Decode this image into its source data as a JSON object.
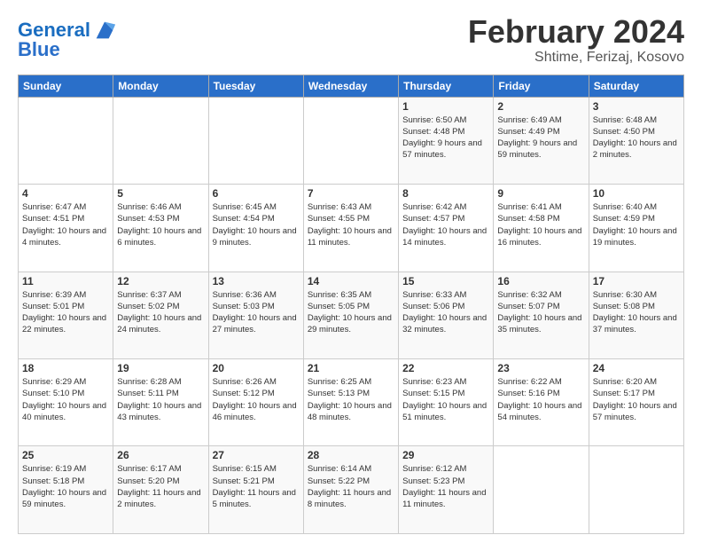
{
  "header": {
    "logo_line1": "General",
    "logo_line2": "Blue",
    "month_year": "February 2024",
    "location": "Shtime, Ferizaj, Kosovo"
  },
  "weekdays": [
    "Sunday",
    "Monday",
    "Tuesday",
    "Wednesday",
    "Thursday",
    "Friday",
    "Saturday"
  ],
  "weeks": [
    [
      {
        "day": "",
        "info": ""
      },
      {
        "day": "",
        "info": ""
      },
      {
        "day": "",
        "info": ""
      },
      {
        "day": "",
        "info": ""
      },
      {
        "day": "1",
        "info": "Sunrise: 6:50 AM\nSunset: 4:48 PM\nDaylight: 9 hours\nand 57 minutes."
      },
      {
        "day": "2",
        "info": "Sunrise: 6:49 AM\nSunset: 4:49 PM\nDaylight: 9 hours\nand 59 minutes."
      },
      {
        "day": "3",
        "info": "Sunrise: 6:48 AM\nSunset: 4:50 PM\nDaylight: 10 hours\nand 2 minutes."
      }
    ],
    [
      {
        "day": "4",
        "info": "Sunrise: 6:47 AM\nSunset: 4:51 PM\nDaylight: 10 hours\nand 4 minutes."
      },
      {
        "day": "5",
        "info": "Sunrise: 6:46 AM\nSunset: 4:53 PM\nDaylight: 10 hours\nand 6 minutes."
      },
      {
        "day": "6",
        "info": "Sunrise: 6:45 AM\nSunset: 4:54 PM\nDaylight: 10 hours\nand 9 minutes."
      },
      {
        "day": "7",
        "info": "Sunrise: 6:43 AM\nSunset: 4:55 PM\nDaylight: 10 hours\nand 11 minutes."
      },
      {
        "day": "8",
        "info": "Sunrise: 6:42 AM\nSunset: 4:57 PM\nDaylight: 10 hours\nand 14 minutes."
      },
      {
        "day": "9",
        "info": "Sunrise: 6:41 AM\nSunset: 4:58 PM\nDaylight: 10 hours\nand 16 minutes."
      },
      {
        "day": "10",
        "info": "Sunrise: 6:40 AM\nSunset: 4:59 PM\nDaylight: 10 hours\nand 19 minutes."
      }
    ],
    [
      {
        "day": "11",
        "info": "Sunrise: 6:39 AM\nSunset: 5:01 PM\nDaylight: 10 hours\nand 22 minutes."
      },
      {
        "day": "12",
        "info": "Sunrise: 6:37 AM\nSunset: 5:02 PM\nDaylight: 10 hours\nand 24 minutes."
      },
      {
        "day": "13",
        "info": "Sunrise: 6:36 AM\nSunset: 5:03 PM\nDaylight: 10 hours\nand 27 minutes."
      },
      {
        "day": "14",
        "info": "Sunrise: 6:35 AM\nSunset: 5:05 PM\nDaylight: 10 hours\nand 29 minutes."
      },
      {
        "day": "15",
        "info": "Sunrise: 6:33 AM\nSunset: 5:06 PM\nDaylight: 10 hours\nand 32 minutes."
      },
      {
        "day": "16",
        "info": "Sunrise: 6:32 AM\nSunset: 5:07 PM\nDaylight: 10 hours\nand 35 minutes."
      },
      {
        "day": "17",
        "info": "Sunrise: 6:30 AM\nSunset: 5:08 PM\nDaylight: 10 hours\nand 37 minutes."
      }
    ],
    [
      {
        "day": "18",
        "info": "Sunrise: 6:29 AM\nSunset: 5:10 PM\nDaylight: 10 hours\nand 40 minutes."
      },
      {
        "day": "19",
        "info": "Sunrise: 6:28 AM\nSunset: 5:11 PM\nDaylight: 10 hours\nand 43 minutes."
      },
      {
        "day": "20",
        "info": "Sunrise: 6:26 AM\nSunset: 5:12 PM\nDaylight: 10 hours\nand 46 minutes."
      },
      {
        "day": "21",
        "info": "Sunrise: 6:25 AM\nSunset: 5:13 PM\nDaylight: 10 hours\nand 48 minutes."
      },
      {
        "day": "22",
        "info": "Sunrise: 6:23 AM\nSunset: 5:15 PM\nDaylight: 10 hours\nand 51 minutes."
      },
      {
        "day": "23",
        "info": "Sunrise: 6:22 AM\nSunset: 5:16 PM\nDaylight: 10 hours\nand 54 minutes."
      },
      {
        "day": "24",
        "info": "Sunrise: 6:20 AM\nSunset: 5:17 PM\nDaylight: 10 hours\nand 57 minutes."
      }
    ],
    [
      {
        "day": "25",
        "info": "Sunrise: 6:19 AM\nSunset: 5:18 PM\nDaylight: 10 hours\nand 59 minutes."
      },
      {
        "day": "26",
        "info": "Sunrise: 6:17 AM\nSunset: 5:20 PM\nDaylight: 11 hours\nand 2 minutes."
      },
      {
        "day": "27",
        "info": "Sunrise: 6:15 AM\nSunset: 5:21 PM\nDaylight: 11 hours\nand 5 minutes."
      },
      {
        "day": "28",
        "info": "Sunrise: 6:14 AM\nSunset: 5:22 PM\nDaylight: 11 hours\nand 8 minutes."
      },
      {
        "day": "29",
        "info": "Sunrise: 6:12 AM\nSunset: 5:23 PM\nDaylight: 11 hours\nand 11 minutes."
      },
      {
        "day": "",
        "info": ""
      },
      {
        "day": "",
        "info": ""
      }
    ]
  ]
}
